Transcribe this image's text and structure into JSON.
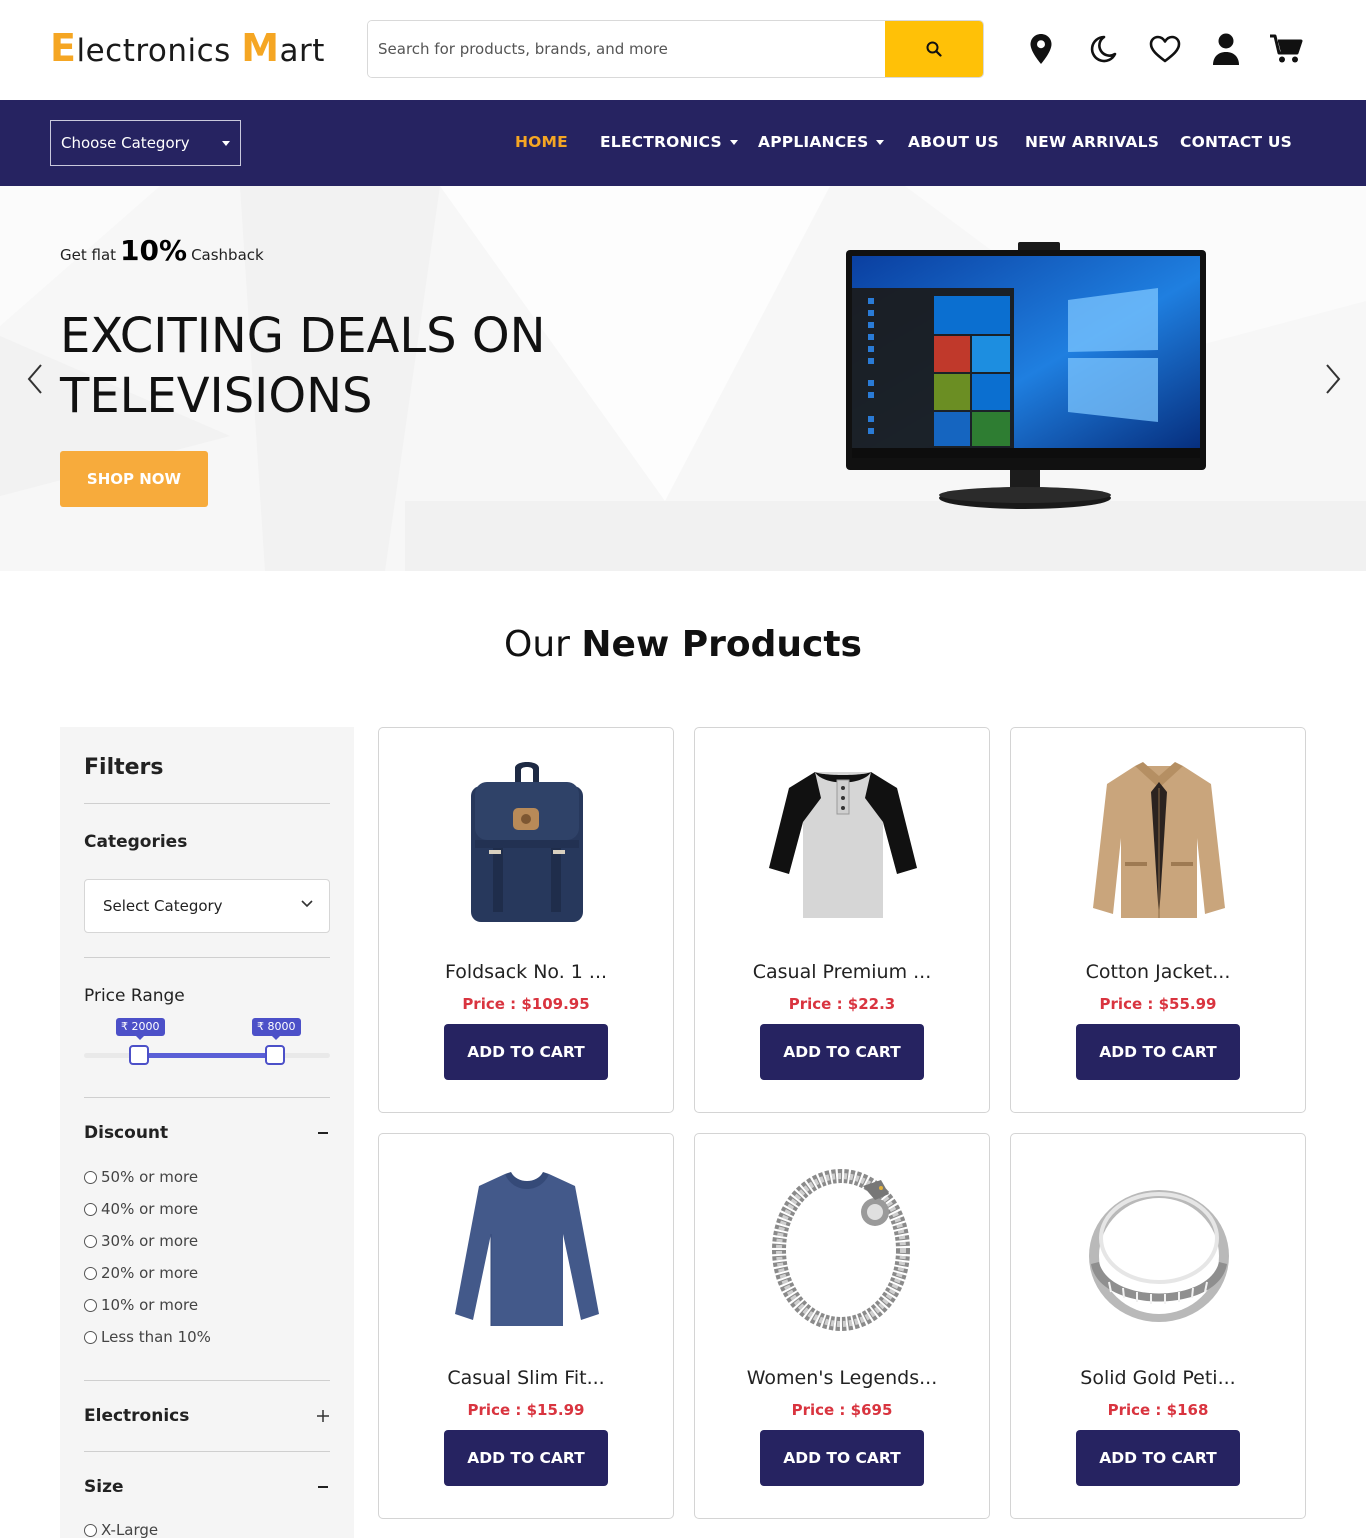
{
  "header": {
    "logo_e": "E",
    "logo_rest1": "lectronics ",
    "logo_m": "M",
    "logo_rest2": "art",
    "search_placeholder": "Search for products, brands, and more",
    "icons": [
      "location-icon",
      "moon-icon",
      "heart-icon",
      "user-icon",
      "cart-icon"
    ]
  },
  "nav": {
    "category_label": "Choose Category",
    "items": [
      {
        "label": "HOME",
        "active": true
      },
      {
        "label": "ELECTRONICS",
        "dropdown": true
      },
      {
        "label": "APPLIANCES",
        "dropdown": true
      },
      {
        "label": "ABOUT US"
      },
      {
        "label": "NEW ARRIVALS"
      },
      {
        "label": "CONTACT US"
      }
    ]
  },
  "hero": {
    "prefix": "Get flat",
    "percent": "10%",
    "suffix": "Cashback",
    "title_line1": "EXCITING DEALS ON",
    "title_line2": "TELEVISIONS",
    "button": "SHOP NOW"
  },
  "section": {
    "title_light": "Our",
    "title_bold": "New Products"
  },
  "filters": {
    "title": "Filters",
    "categories_heading": "Categories",
    "category_select": "Select Category",
    "price_heading": "Price Range",
    "price_min": "₹ 2000",
    "price_max": "₹ 8000",
    "price_min_value": 2000,
    "price_max_value": 8000,
    "discount_heading": "Discount",
    "discount_options": [
      "50% or more",
      "40% or more",
      "30% or more",
      "20% or more",
      "10% or more",
      "Less than 10%"
    ],
    "electronics_heading": "Electronics",
    "size_heading": "Size",
    "size_options": [
      "X-Large"
    ]
  },
  "products": [
    {
      "name": "Foldsack No. 1 ...",
      "price": "Price : $109.95",
      "button": "ADD TO CART"
    },
    {
      "name": "Casual Premium ...",
      "price": "Price : $22.3",
      "button": "ADD TO CART"
    },
    {
      "name": "Cotton Jacket...",
      "price": "Price : $55.99",
      "button": "ADD TO CART"
    },
    {
      "name": "Casual Slim Fit...",
      "price": "Price : $15.99",
      "button": "ADD TO CART"
    },
    {
      "name": "Women's Legends...",
      "price": "Price : $695",
      "button": "ADD TO CART"
    },
    {
      "name": "Solid Gold Peti...",
      "price": "Price : $168",
      "button": "ADD TO CART"
    }
  ],
  "colors": {
    "brand_dark": "#262361",
    "accent_orange": "#f5a623",
    "search_yellow": "#ffc107",
    "price_red": "#d9343f",
    "slider_blue": "#4c50c8"
  }
}
